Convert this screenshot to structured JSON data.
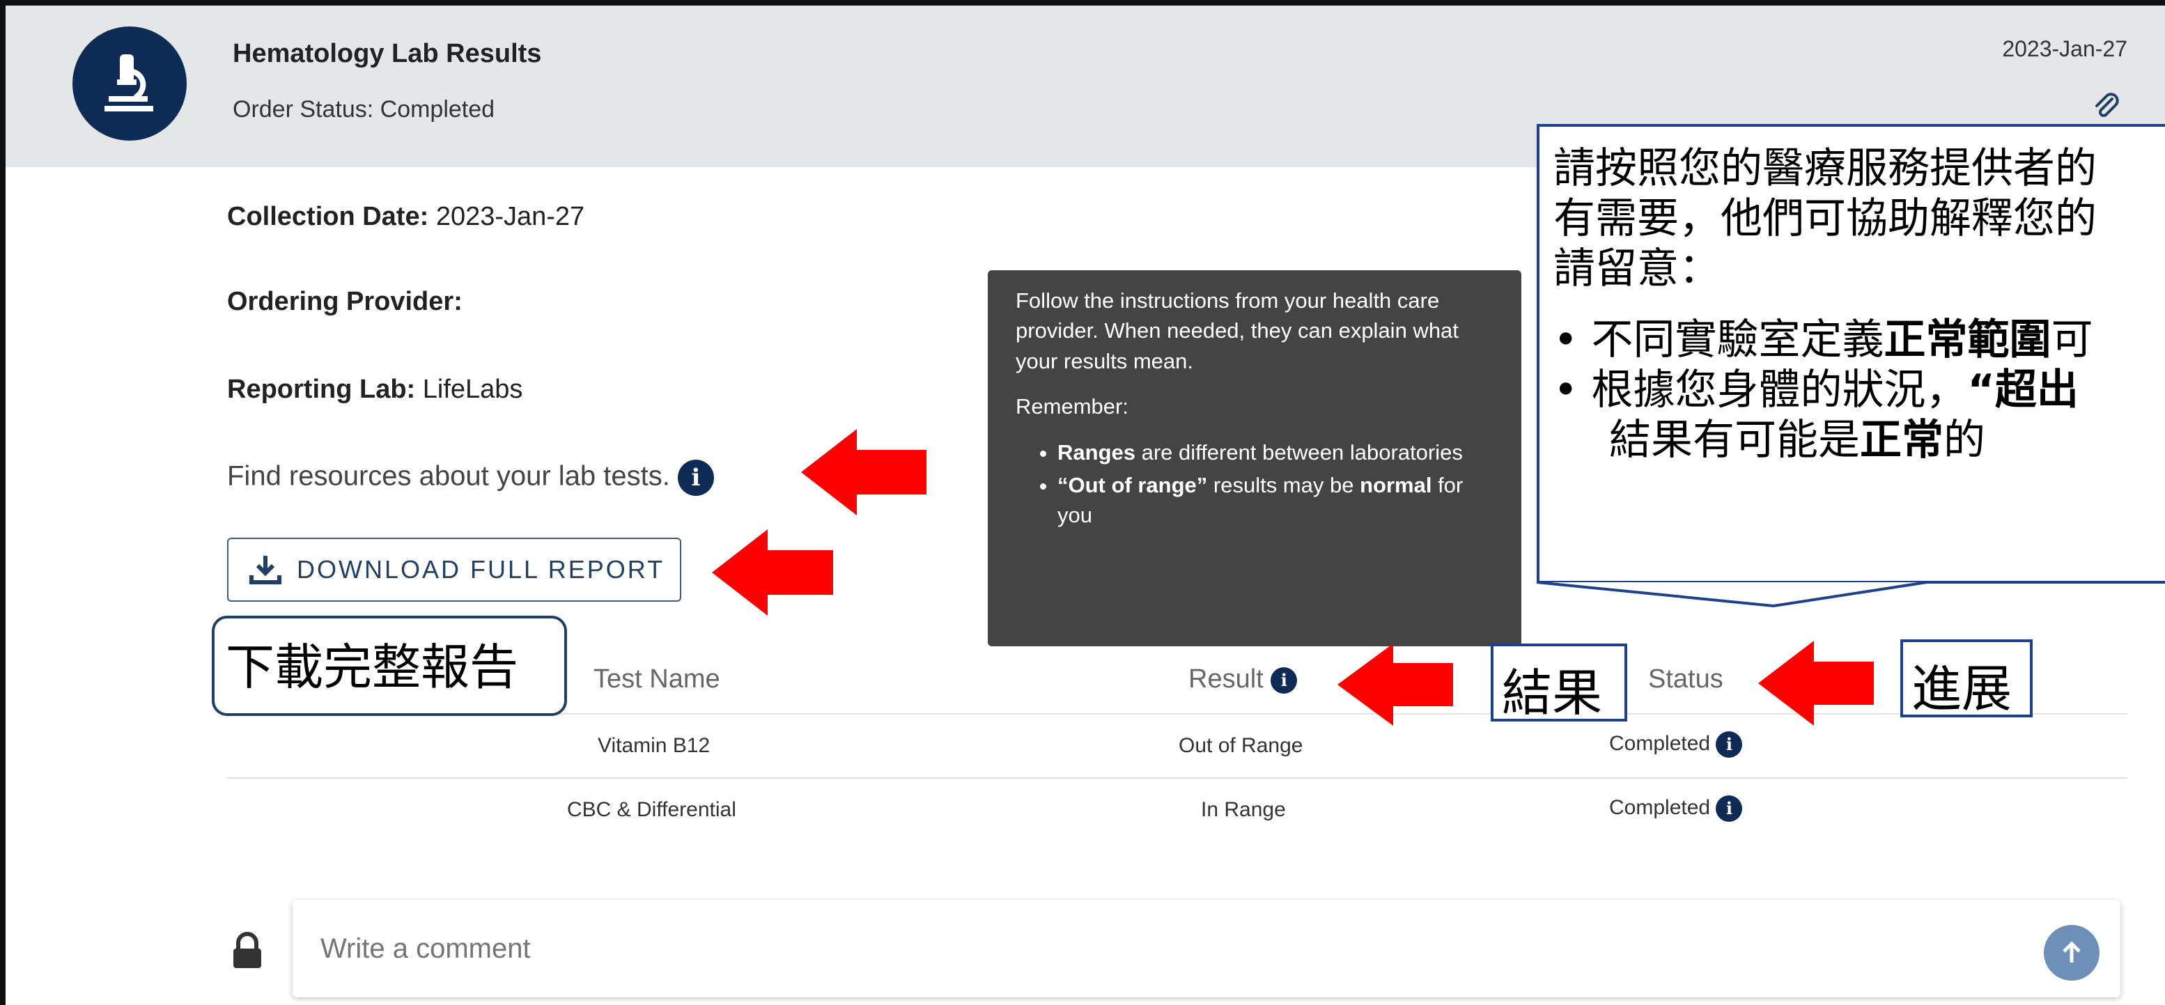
{
  "header": {
    "title": "Hematology Lab Results",
    "order_status": "Order Status: Completed",
    "date": "2023-Jan-27"
  },
  "info": {
    "collection_label": "Collection Date:",
    "collection_value": "2023-Jan-27",
    "provider_label": "Ordering Provider:",
    "reporting_label": "Reporting Lab:",
    "reporting_value": "LifeLabs",
    "resources_text": "Find resources about your lab tests."
  },
  "download_button": "DOWNLOAD FULL REPORT",
  "table": {
    "headers": [
      "Test Name",
      "Result",
      "Status"
    ],
    "rows": [
      {
        "test": "Vitamin B12",
        "result": "Out of Range",
        "status": "Completed"
      },
      {
        "test": "CBC & Differential",
        "result": "In Range",
        "status": "Completed"
      }
    ]
  },
  "tooltip": {
    "para1": "Follow the instructions from your health care provider. When needed, they can explain what your results mean.",
    "para2": "Remember:",
    "b1_bold": "Ranges",
    "b1_rest": " are different between laboratories",
    "b2_bold": "“Out of range”",
    "b2_rest": " results may be ",
    "b2_bold2": "normal",
    "b2_end": " for you"
  },
  "comment": {
    "placeholder": "Write a comment"
  },
  "callout": {
    "line1": "請按照您的醫療服務提供者的",
    "line2": "有需要，他們可協助解釋您的",
    "line3": "請留意：",
    "bullet1_pre": "不同實驗室定義",
    "bullet1_bold": "正常範圍",
    "bullet1_post": "可",
    "bullet2_pre": "根據您身體的狀況，",
    "bullet2_bold": "“超出",
    "bullet2b_pre": "結果有可能是",
    "bullet2b_bold": "正常",
    "bullet2b_post": "的"
  },
  "labels": {
    "download_cn": "下載完整報告",
    "result_cn": "結果",
    "progress_cn": "進展"
  },
  "colors": {
    "navy": "#0e2b55",
    "arrow_red": "#ff0000",
    "tooltip_bg": "#444444"
  }
}
